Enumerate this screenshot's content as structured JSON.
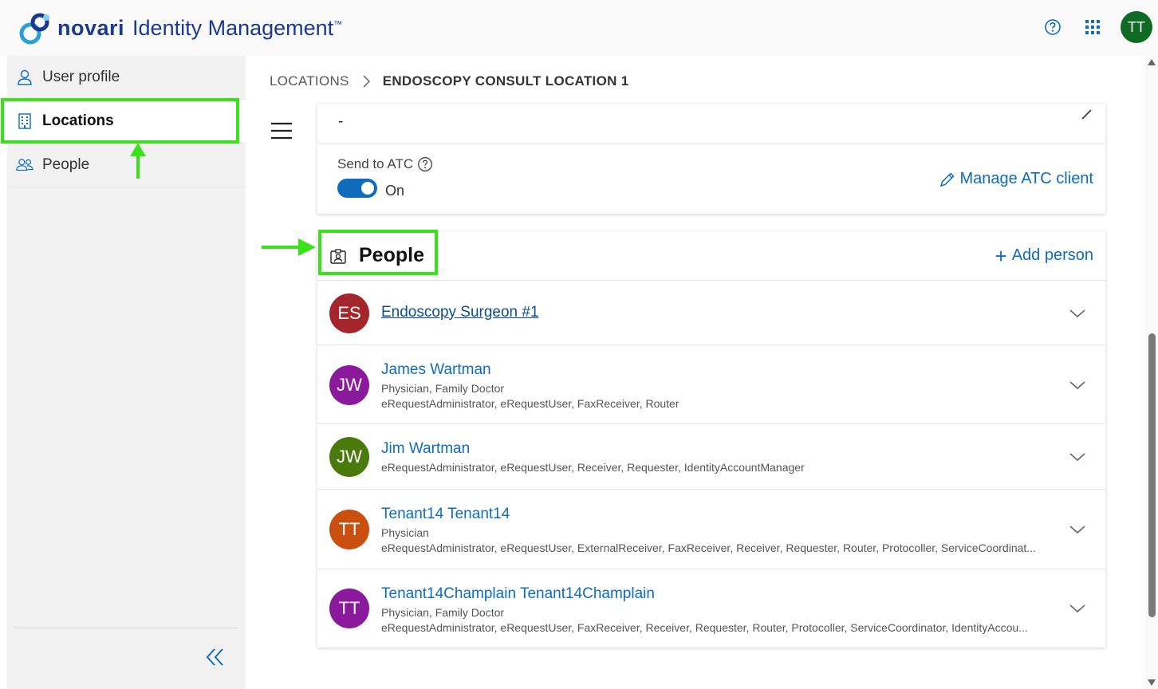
{
  "header": {
    "brand": "novari",
    "product": "Identity Management",
    "tm": "™",
    "help_icon": "help-circle-icon",
    "apps_icon": "app-grid-icon",
    "avatar_initials": "TT",
    "avatar_color": "#0f6b23"
  },
  "sidebar": {
    "items": [
      {
        "label": "User profile",
        "icon": "person-icon",
        "active": false
      },
      {
        "label": "Locations",
        "icon": "building-icon",
        "active": true
      },
      {
        "label": "People",
        "icon": "people-icon",
        "active": false
      }
    ],
    "collapse_icon": "double-chevron-left-icon"
  },
  "breadcrumb": {
    "parent": "LOCATIONS",
    "current": "ENDOSCOPY CONSULT LOCATION 1"
  },
  "details_card": {
    "value": "-",
    "send_to_atc_label": "Send to ATC",
    "toggle_state": "On",
    "manage_atc_label": "Manage ATC client"
  },
  "people_card": {
    "title": "People",
    "add_person_label": "Add person",
    "people": [
      {
        "initials": "ES",
        "name": "Endoscopy Surgeon #1",
        "color": "#a4262c",
        "line2": "",
        "line3": ""
      },
      {
        "initials": "JW",
        "name": "James Wartman",
        "color": "#8a1a9b",
        "line2": "Physician, Family Doctor",
        "line3": "eRequestAdministrator, eRequestUser, FaxReceiver, Router"
      },
      {
        "initials": "JW",
        "name": "Jim Wartman",
        "color": "#4a7a0c",
        "line2": "",
        "line3": "eRequestAdministrator, eRequestUser, Receiver, Requester, IdentityAccountManager"
      },
      {
        "initials": "TT",
        "name": "Tenant14 Tenant14",
        "color": "#ca5010",
        "line2": "Physician",
        "line3": "eRequestAdministrator, eRequestUser, ExternalReceiver, FaxReceiver, Receiver, Requester, Router, Protocoller, ServiceCoordinat..."
      },
      {
        "initials": "TT",
        "name": "Tenant14Champlain Tenant14Champlain",
        "color": "#8a1a9b",
        "line2": "Physician, Family Doctor",
        "line3": "eRequestAdministrator, eRequestUser, FaxReceiver, Receiver, Requester, Router, Protocoller, ServiceCoordinator, IdentityAccou..."
      }
    ]
  },
  "annotations": {
    "highlight_color": "#39e21a"
  }
}
